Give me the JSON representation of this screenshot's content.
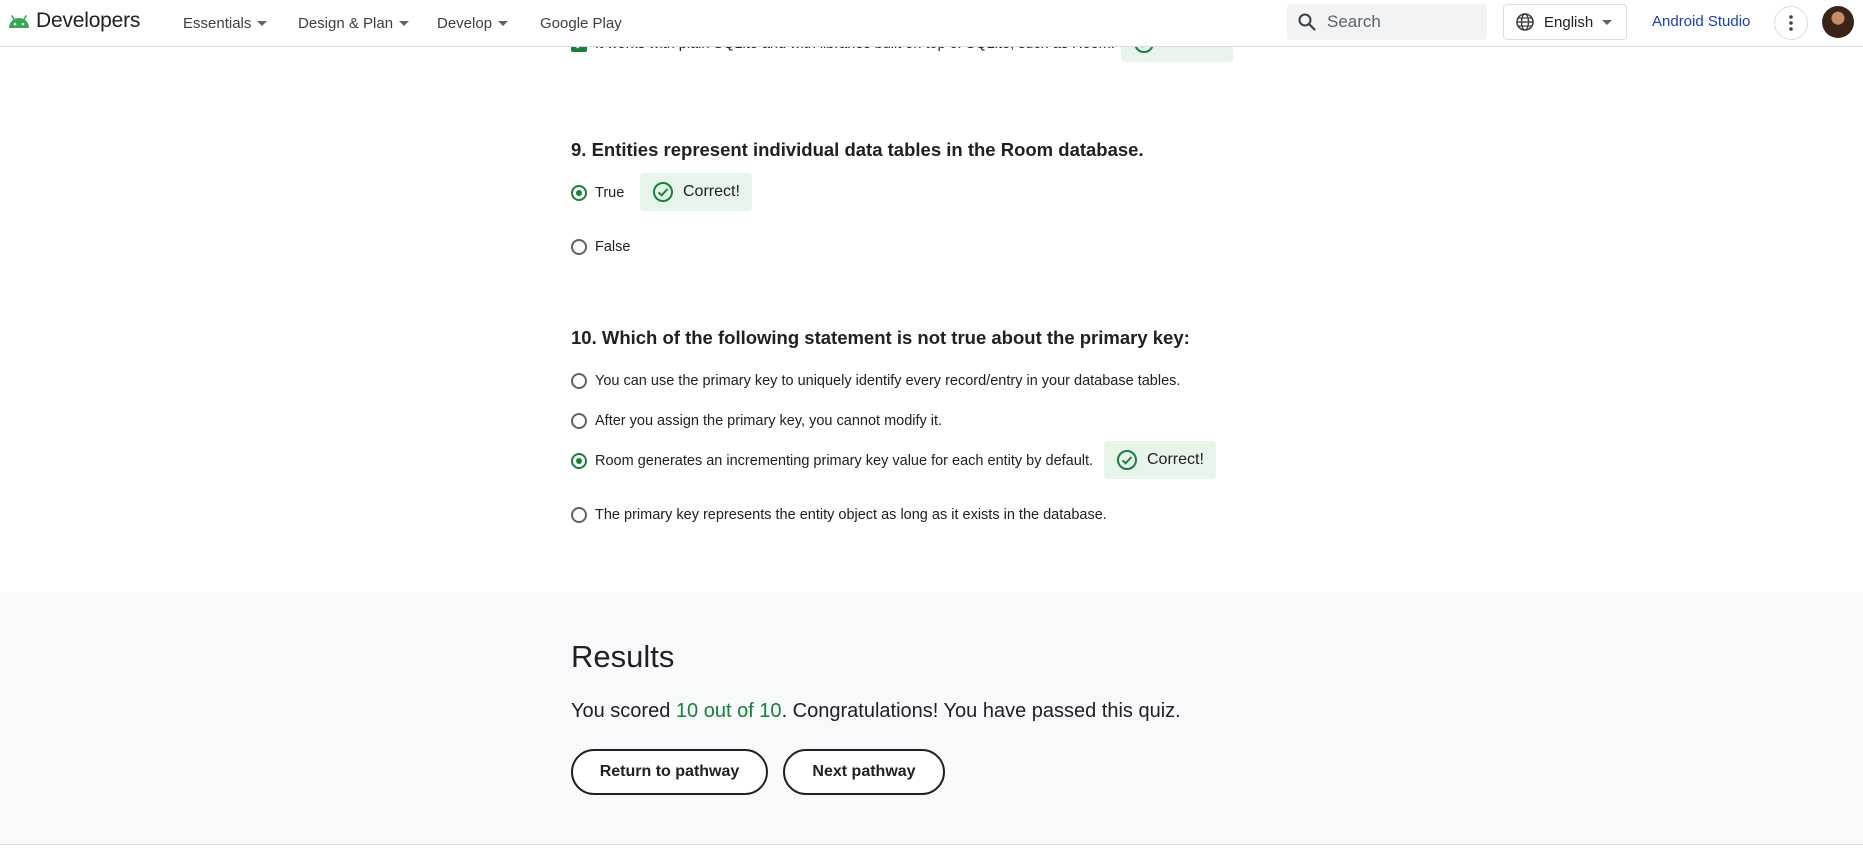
{
  "header": {
    "logo_text": "Developers",
    "nav": [
      {
        "label": "Essentials",
        "has_dropdown": true
      },
      {
        "label": "Design & Plan",
        "has_dropdown": true
      },
      {
        "label": "Develop",
        "has_dropdown": true
      },
      {
        "label": "Google Play",
        "has_dropdown": false
      }
    ],
    "search_placeholder": "Search",
    "language": "English",
    "android_studio": "Android Studio"
  },
  "quiz": {
    "prev_option": "It works with plain SQLite and with libraries built on top of SQLite, such as Room.",
    "prev_feedback": "Correct!",
    "q9": {
      "title": "9. Entities represent individual data tables in the Room database.",
      "options": [
        "True",
        "False"
      ],
      "selected": 0,
      "feedback": "Correct!"
    },
    "q10": {
      "title": "10. Which of the following statement is not true about the primary key:",
      "options": [
        "You can use the primary key to uniquely identify every record/entry in your database tables.",
        "After you assign the primary key, you cannot modify it.",
        "Room generates an incrementing primary key value for each entity by default.",
        "The primary key represents the entity object as long as it exists in the database."
      ],
      "selected": 2,
      "feedback": "Correct!"
    }
  },
  "results": {
    "title": "Results",
    "prefix": "You scored ",
    "score": "10 out of 10",
    "suffix": ". Congratulations! You have passed this quiz.",
    "return_button": "Return to pathway",
    "next_button": "Next pathway"
  },
  "colors": {
    "accent_green": "#188038",
    "correct_bg": "#e6f4ea",
    "link_blue": "#1a3fb2"
  }
}
